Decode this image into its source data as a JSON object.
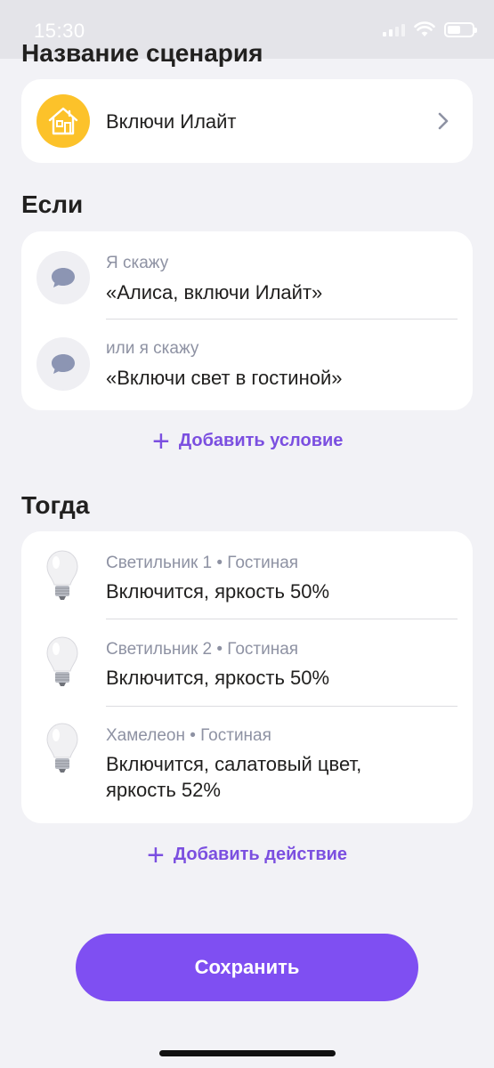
{
  "status_bar": {
    "time": "15:30"
  },
  "scenario": {
    "section_title": "Название сценария",
    "name": "Включи Илайт"
  },
  "if_section": {
    "title": "Если",
    "conditions": [
      {
        "caption": "Я скажу",
        "phrase": "«Алиса, включи Илайт»"
      },
      {
        "caption": "или я скажу",
        "phrase": "«Включи свет в гостиной»"
      }
    ],
    "add_label": "Добавить условие"
  },
  "then_section": {
    "title": "Тогда",
    "actions": [
      {
        "device": "Светильник 1 • Гостиная",
        "result": "Включится, яркость 50%"
      },
      {
        "device": "Светильник 2 • Гостиная",
        "result": "Включится, яркость 50%"
      },
      {
        "device": "Хамелеон • Гостиная",
        "result_line1": "Включится, салатовый цвет,",
        "result_line2": "яркость 52%"
      }
    ],
    "add_label": "Добавить действие"
  },
  "save_label": "Сохранить",
  "colors": {
    "accent": "#7f4ff2",
    "link": "#7b4fe0",
    "home_icon_bg": "#fcc22a"
  }
}
